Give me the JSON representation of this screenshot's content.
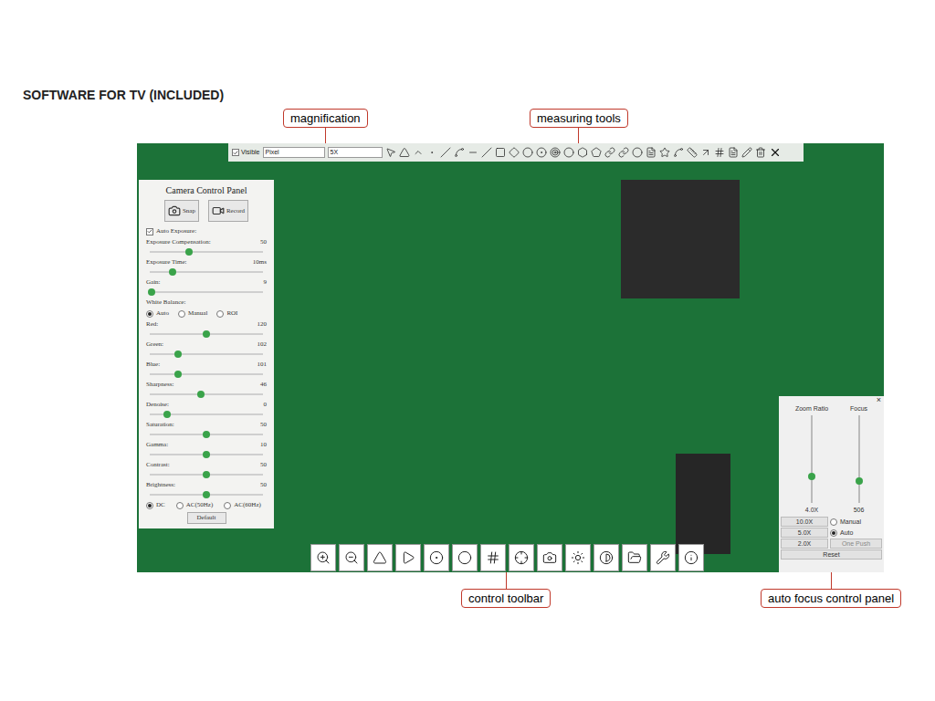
{
  "heading": "SOFTWARE FOR TV (INCLUDED)",
  "callouts": {
    "top": [
      "magnification",
      "measuring tools"
    ],
    "bottom": [
      "control toolbar",
      "auto focus control panel"
    ]
  },
  "measure_toolbar": {
    "visible": {
      "label": "Visible",
      "checked": true
    },
    "unit": "Pixel",
    "magnification": "5X"
  },
  "camera_panel": {
    "title": "Camera Control Panel",
    "snap": "Snap",
    "record": "Record",
    "auto_exposure": {
      "label": "Auto Exposure:",
      "checked": true
    },
    "exposure_sliders": [
      {
        "label": "Exposure Compensation:",
        "value": "50",
        "level": 0.35
      },
      {
        "label": "Exposure Time:",
        "value": "10ms",
        "level": 0.2
      },
      {
        "label": "Gain:",
        "value": "9",
        "level": 0.02
      }
    ],
    "white_balance": {
      "label": "White Balance:",
      "options": [
        {
          "label": "Auto",
          "selected": true
        },
        {
          "label": "Manual",
          "selected": false
        },
        {
          "label": "ROI",
          "selected": false
        }
      ]
    },
    "wb_sliders": [
      {
        "label": "Red:",
        "value": "120",
        "level": 0.5
      },
      {
        "label": "Green:",
        "value": "102",
        "level": 0.25
      },
      {
        "label": "Blue:",
        "value": "101",
        "level": 0.25
      }
    ],
    "image_sliders": [
      {
        "label": "Sharpness:",
        "value": "46",
        "level": 0.45
      },
      {
        "label": "Denoise:",
        "value": "0",
        "level": 0.15
      },
      {
        "label": "Saturation:",
        "value": "50",
        "level": 0.5
      },
      {
        "label": "Gamma:",
        "value": "10",
        "level": 0.5
      },
      {
        "label": "Contrast:",
        "value": "50",
        "level": 0.5
      },
      {
        "label": "Brightness:",
        "value": "50",
        "level": 0.5
      }
    ],
    "power_options": [
      {
        "label": "DC",
        "selected": true
      },
      {
        "label": "AC(50Hz)",
        "selected": false
      },
      {
        "label": "AC(60Hz)",
        "selected": false
      }
    ],
    "default_button": "Default"
  },
  "auto_focus": {
    "close": "×",
    "zoom": {
      "label": "Zoom Ratio",
      "value": "4.0X",
      "level": 0.3
    },
    "focus": {
      "label": "Focus",
      "value": "506",
      "level": 0.25
    },
    "rows": [
      {
        "button": "10.0X",
        "kind": "radio",
        "label": "Manual",
        "selected": false
      },
      {
        "button": "5.0X",
        "kind": "radio",
        "label": "Auto",
        "selected": true
      },
      {
        "button": "2.0X",
        "kind": "button",
        "label": "One Push",
        "selected": false
      }
    ],
    "reset": "Reset"
  }
}
